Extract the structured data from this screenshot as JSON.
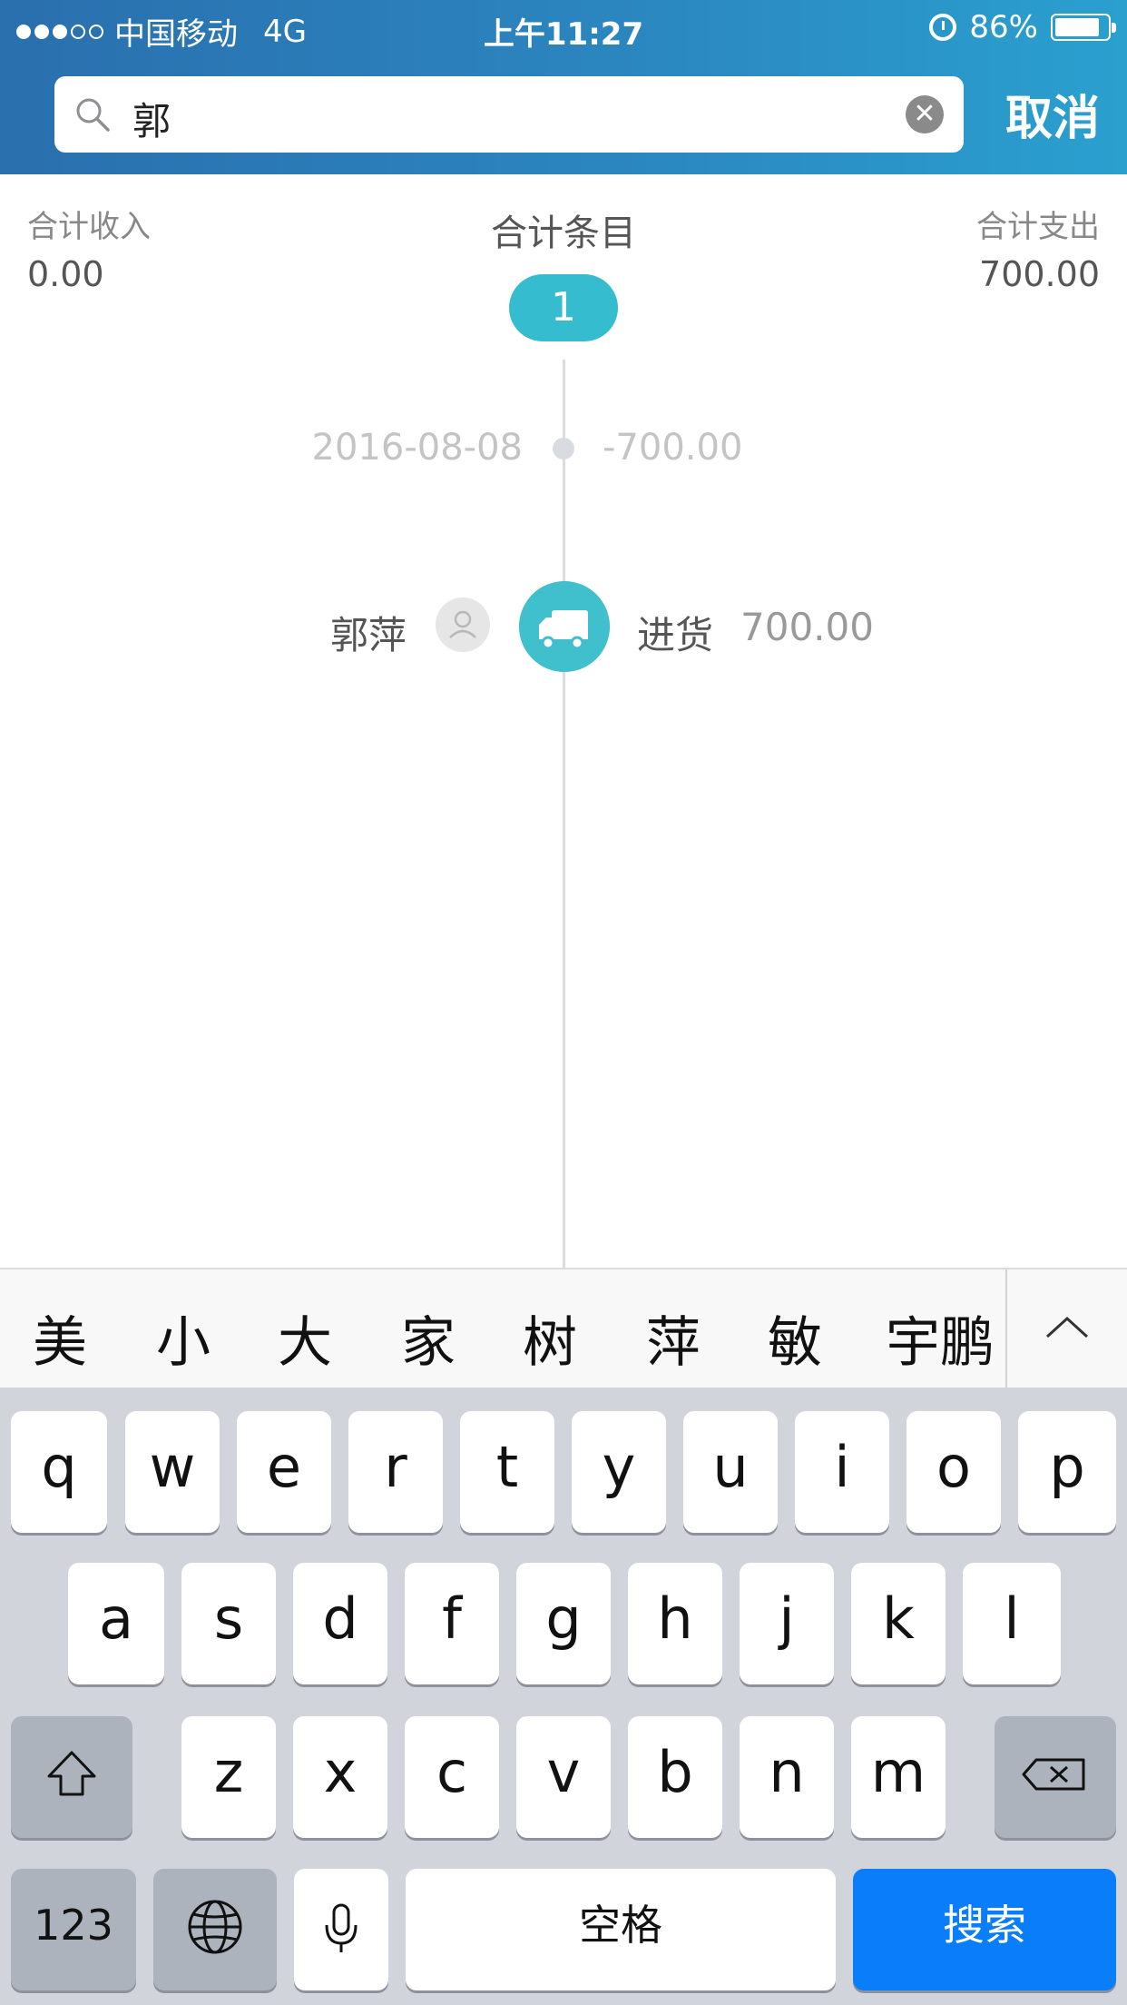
{
  "status_bar": {
    "carrier": "中国移动",
    "network": "4G",
    "time": "上午11:27",
    "battery": "86%",
    "battery_level": 0.86
  },
  "search": {
    "query": "郭",
    "cancel_label": "取消"
  },
  "summary": {
    "income_label": "合计收入",
    "income_value": "0.00",
    "count_label": "合计条目",
    "count_value": "1",
    "expense_label": "合计支出",
    "expense_value": "700.00"
  },
  "timeline": {
    "date": "2016-08-08",
    "day_total": "-700.00",
    "entries": [
      {
        "person": "郭萍",
        "category": "进货",
        "amount": "700.00",
        "icon": "truck-icon"
      }
    ]
  },
  "suggestions": [
    "美",
    "小",
    "大",
    "家",
    "树",
    "萍",
    "敏",
    "宇鹏"
  ],
  "keyboard": {
    "row1": [
      "q",
      "w",
      "e",
      "r",
      "t",
      "y",
      "u",
      "i",
      "o",
      "p"
    ],
    "row2": [
      "a",
      "s",
      "d",
      "f",
      "g",
      "h",
      "j",
      "k",
      "l"
    ],
    "row3": [
      "z",
      "x",
      "c",
      "v",
      "b",
      "n",
      "m"
    ],
    "numbers_label": "123",
    "space_label": "空格",
    "search_label": "搜索"
  },
  "colors": {
    "header_start": "#2a6fae",
    "header_end": "#2aa0cf",
    "accent": "#35bccf",
    "search_key": "#0a7dfb"
  }
}
